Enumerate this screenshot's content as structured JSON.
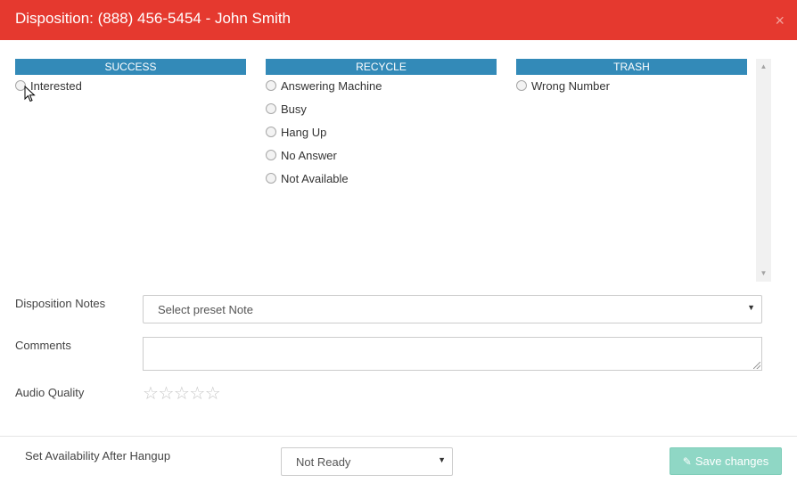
{
  "header": {
    "title": "Disposition: (888) 456-5454 - John Smith",
    "close_glyph": "×"
  },
  "columns": [
    {
      "title": "SUCCESS",
      "options": [
        "Interested"
      ]
    },
    {
      "title": "RECYCLE",
      "options": [
        "Answering Machine",
        "Busy",
        "Hang Up",
        "No Answer",
        "Not Available"
      ]
    },
    {
      "title": "TRASH",
      "options": [
        "Wrong Number"
      ]
    }
  ],
  "scrollbar": {
    "up_icon": "triangle-up-icon",
    "down_icon": "triangle-down-icon"
  },
  "form": {
    "notes_label": "Disposition Notes",
    "notes_select_value": "Select preset Note",
    "comments_label": "Comments",
    "comments_value": "",
    "audio_label": "Audio Quality",
    "audio_rating": 0,
    "audio_rating_max": 5
  },
  "footer": {
    "availability_label": "Set Availability After Hangup",
    "availability_value": "Not Ready",
    "save_label": "Save changes",
    "save_icon": "edit-icon"
  },
  "colors": {
    "header_bg": "#e5392f",
    "column_header_bg": "#338ab8",
    "save_button_bg": "#8fd7c5"
  }
}
